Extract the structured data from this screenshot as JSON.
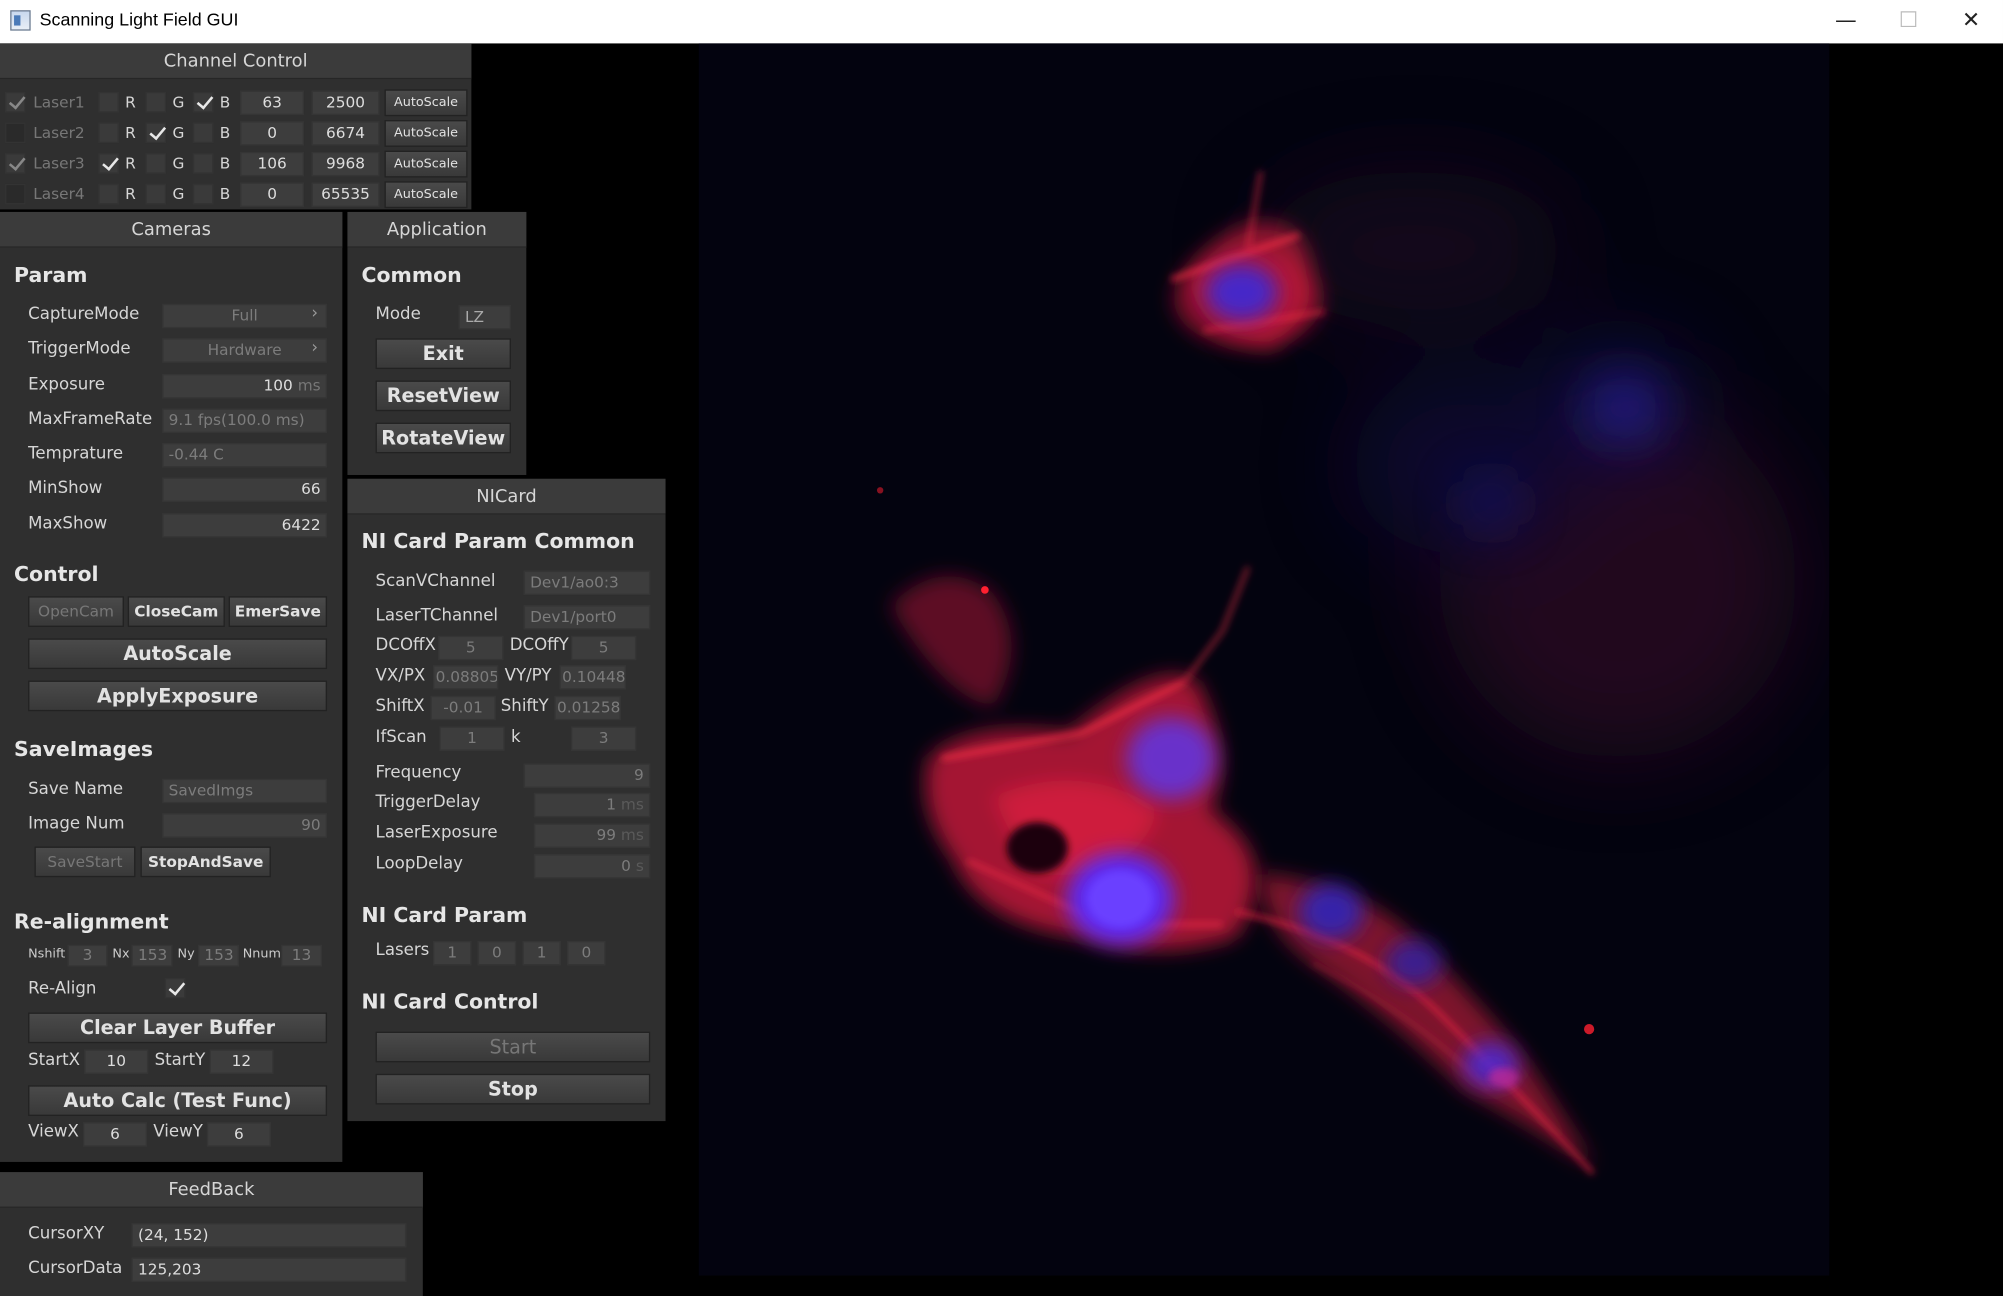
{
  "window": {
    "title": "Scanning Light Field GUI",
    "minimize": "—",
    "maximize": "☐",
    "close": "✕"
  },
  "channel_control": {
    "title": "Channel Control",
    "channels": [
      {
        "name": "Laser1",
        "enabled": true,
        "r": false,
        "g": false,
        "b": true,
        "min": "63",
        "max": "2500",
        "autoscale": "AutoScale"
      },
      {
        "name": "Laser2",
        "enabled": false,
        "r": false,
        "g": true,
        "b": false,
        "min": "0",
        "max": "6674",
        "autoscale": "AutoScale"
      },
      {
        "name": "Laser3",
        "enabled": true,
        "r": true,
        "g": false,
        "b": false,
        "min": "106",
        "max": "9968",
        "autoscale": "AutoScale"
      },
      {
        "name": "Laser4",
        "enabled": false,
        "r": false,
        "g": false,
        "b": false,
        "min": "0",
        "max": "65535",
        "autoscale": "AutoScale"
      }
    ],
    "r_label": "R",
    "g_label": "G",
    "b_label": "B"
  },
  "cameras": {
    "title": "Cameras",
    "param": {
      "heading": "Param",
      "capture_mode_label": "CaptureMode",
      "capture_mode_value": "Full",
      "trigger_mode_label": "TriggerMode",
      "trigger_mode_value": "Hardware",
      "exposure_label": "Exposure",
      "exposure_value": "100",
      "exposure_unit": "ms",
      "max_frame_rate_label": "MaxFrameRate",
      "max_frame_rate_value": "9.1 fps(100.0 ms)",
      "temperature_label": "Temprature",
      "temperature_value": "-0.44 C",
      "min_show_label": "MinShow",
      "min_show_value": "66",
      "max_show_label": "MaxShow",
      "max_show_value": "6422"
    },
    "control": {
      "heading": "Control",
      "open_cam": "OpenCam",
      "close_cam": "CloseCam",
      "emer_save": "EmerSave",
      "autoscale": "AutoScale",
      "apply_exposure": "ApplyExposure"
    },
    "save_images": {
      "heading": "SaveImages",
      "save_name_label": "Save Name",
      "save_name_value": "SavedImgs",
      "image_num_label": "Image Num",
      "image_num_value": "90",
      "save_start": "SaveStart",
      "stop_and_save": "StopAndSave"
    },
    "realign": {
      "heading": "Re-alignment",
      "nshift_label": "Nshift",
      "nshift_value": "3",
      "nx_label": "Nx",
      "nx_value": "153",
      "ny_label": "Ny",
      "ny_value": "153",
      "nnum_label": "Nnum",
      "nnum_value": "13",
      "realign_label": "Re-Align",
      "realign_checked": true,
      "clear_layer_buffer": "Clear Layer Buffer",
      "startx_label": "StartX",
      "startx_value": "10",
      "starty_label": "StartY",
      "starty_value": "12",
      "auto_calc": "Auto Calc (Test Func)",
      "viewx_label": "ViewX",
      "viewx_value": "6",
      "viewy_label": "ViewY",
      "viewy_value": "6"
    }
  },
  "application": {
    "title": "Application",
    "heading": "Common",
    "mode_label": "Mode",
    "mode_value": "LZ",
    "exit": "Exit",
    "reset_view": "ResetView",
    "rotate_view": "RotateView"
  },
  "nicard": {
    "title": "NICard",
    "common_heading": "NI Card Param Common",
    "scanv_label": "ScanVChannel",
    "scanv_value": "Dev1/ao0:3",
    "lasert_label": "LaserTChannel",
    "lasert_value": "Dev1/port0",
    "dcoffx_label": "DCOffX",
    "dcoffx_value": "5",
    "dcoffy_label": "DCOffY",
    "dcoffy_value": "5",
    "vxpx_label": "VX/PX",
    "vxpx_value": "0.08805",
    "vypy_label": "VY/PY",
    "vypy_value": "0.10448",
    "shiftx_label": "ShiftX",
    "shiftx_value": "-0.01",
    "shifty_label": "ShiftY",
    "shifty_value": "0.01258",
    "ifscan_label": "IfScan",
    "ifscan_value": "1",
    "k_label": "k",
    "k_value": "3",
    "frequency_label": "Frequency",
    "frequency_value": "9",
    "trigger_delay_label": "TriggerDelay",
    "trigger_delay_value": "1",
    "trigger_delay_unit": "ms",
    "laser_exposure_label": "LaserExposure",
    "laser_exposure_value": "99",
    "laser_exposure_unit": "ms",
    "loop_delay_label": "LoopDelay",
    "loop_delay_value": "0",
    "loop_delay_unit": "s",
    "param_heading": "NI Card Param",
    "lasers_label": "Lasers",
    "lasers_values": [
      "1",
      "0",
      "1",
      "0"
    ],
    "control_heading": "NI Card Control",
    "start": "Start",
    "stop": "Stop"
  },
  "feedback": {
    "title": "FeedBack",
    "cursor_xy_label": "CursorXY",
    "cursor_xy_value": "(24, 152)",
    "cursor_data_label": "CursorData",
    "cursor_data_value": "125,203"
  },
  "colors": {
    "panel_bg": "#2f2f2f",
    "title_bg": "#3b3b3b",
    "field_bg": "#3d3d3d",
    "red_channel": "#ff2030",
    "blue_channel": "#3020ff"
  }
}
